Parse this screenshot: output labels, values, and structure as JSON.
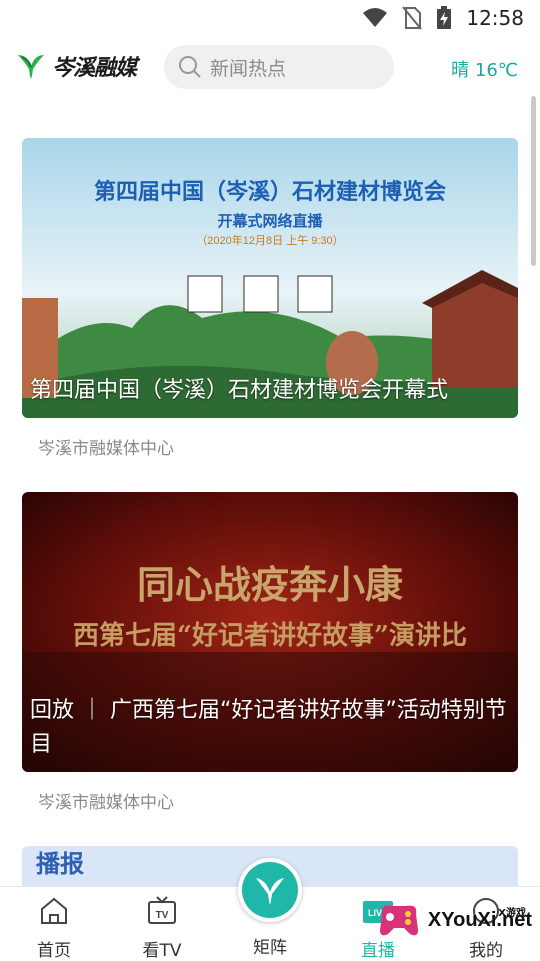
{
  "status_bar": {
    "time": "12:58"
  },
  "header": {
    "logo_text": "岑溪融媒",
    "search_placeholder": "新闻热点",
    "weather": "晴 16℃"
  },
  "cards": [
    {
      "title_image_text": "第四届中国（岑溪）石材建材博览会",
      "subtitle_image_text": "开幕式网络直播",
      "date_image_text": "（2020年12月8日  上午  9:30）",
      "caption": "第四届中国（岑溪）石材建材博览会开幕式",
      "source": "岑溪市融媒体中心"
    },
    {
      "title_image_text": "同心战疫奔小康",
      "subtitle_image_text": "西第七届“好记者讲好故事”演讲比",
      "caption": "回放 ｜ 广西第七届“好记者讲好故事”活动特别节目",
      "source": "岑溪市融媒体中心"
    },
    {
      "title_image_text": "播报"
    }
  ],
  "tabbar": {
    "items": [
      {
        "label": "首页"
      },
      {
        "label": "看TV"
      },
      {
        "label": "矩阵"
      },
      {
        "label": "直播"
      },
      {
        "label": "我的"
      }
    ]
  },
  "watermark": {
    "text": "XYouXi.net",
    "small": "X游戏"
  },
  "colors": {
    "accent": "#19a9a2",
    "fab": "#1fb7a7"
  }
}
